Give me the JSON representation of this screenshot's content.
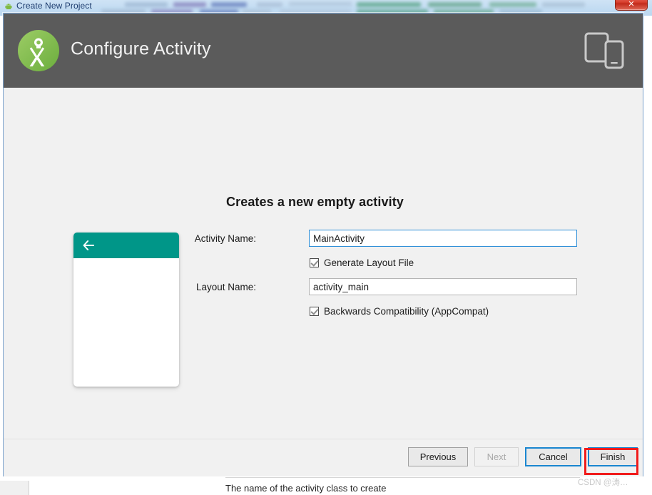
{
  "window": {
    "parent_title": "Create New Project",
    "parent_icon": "android-icon",
    "close_label": "✕"
  },
  "header": {
    "title": "Configure Activity",
    "logo_icon": "android-studio-logo",
    "device_icon": "tablet-phone-icon",
    "background": "#5b5b5b"
  },
  "main": {
    "section_title": "Creates a new empty activity",
    "preview": {
      "appbar_color": "#009688",
      "back_icon": "back-arrow-icon"
    },
    "fields": [
      {
        "label": "Activity Name:",
        "value": "MainActivity",
        "placeholder": "",
        "focused": true
      },
      {
        "label": "Layout Name:",
        "value": "activity_main",
        "placeholder": "",
        "focused": false
      }
    ],
    "checkboxes": [
      {
        "label": "Generate Layout File",
        "checked": true
      },
      {
        "label": "Backwards Compatibility (AppCompat)",
        "checked": true
      }
    ],
    "hint": "The name of the activity class to create"
  },
  "buttons": {
    "previous": "Previous",
    "next": "Next",
    "cancel": "Cancel",
    "finish": "Finish"
  },
  "annotation": {
    "color": "#f01c1c",
    "target": "finish-button"
  },
  "watermark": "CSDN @涛…"
}
